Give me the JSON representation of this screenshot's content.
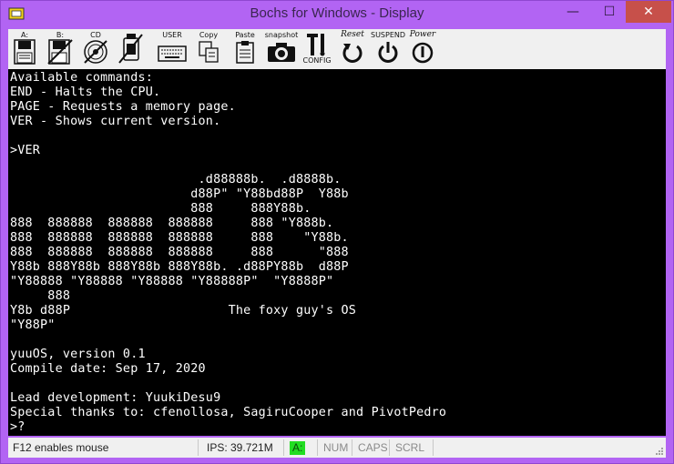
{
  "window": {
    "title": "Bochs for Windows - Display",
    "minimize_glyph": "—",
    "maximize_glyph": "☐",
    "close_glyph": "✕"
  },
  "toolbar": {
    "floppy_a_label": "A:",
    "floppy_b_label": "B:",
    "cdrom_label": "CD",
    "user_label": "USER",
    "copy_label": "Copy",
    "paste_label": "Paste",
    "snapshot_label": "snapshot",
    "config_label": "CONFIG",
    "reset_label": "Reset",
    "suspend_label": "SUSPEND",
    "power_label": "Power",
    "icons": [
      "floppy-a-icon",
      "floppy-b-icon",
      "cdrom-icon",
      "usb-icon",
      "keyboard-icon",
      "copy-icon",
      "paste-icon",
      "camera-icon",
      "config-icon",
      "reset-icon",
      "suspend-icon",
      "power-icon"
    ]
  },
  "console": {
    "lines": [
      "Available commands:",
      "END - Halts the CPU.",
      "PAGE - Requests a memory page.",
      "VER - Shows current version.",
      "",
      ">VER",
      "",
      "                         .d88888b.  .d8888b.",
      "                        d88P\" \"Y88bd88P  Y88b",
      "                        888     888Y88b.",
      "888  888888  888888  888888     888 \"Y888b.",
      "888  888888  888888  888888     888    \"Y88b.",
      "888  888888  888888  888888     888      \"888",
      "Y88b 888Y88b 888Y88b 888Y88b. .d88PY88b  d88P",
      "\"Y88888 \"Y88888 \"Y88888 \"Y88888P\"  \"Y8888P\"",
      "     888",
      "Y8b d88P                     The foxy guy's OS",
      "\"Y88P\"",
      "",
      "yuuOS, version 0.1",
      "Compile date: Sep 17, 2020",
      "",
      "Lead development: YuukiDesu9",
      "Special thanks to: cfenollosa, SagiruCooper and PivotPedro",
      ">?"
    ]
  },
  "statusbar": {
    "mouse_hint": "F12 enables mouse",
    "ips": "IPS: 39.721M",
    "drive": "A:",
    "num": "NUM",
    "caps": "CAPS",
    "scrl": "SCRL"
  },
  "colors": {
    "titlebar": "#b264f3",
    "drive_active": "#22dd22",
    "console_bg": "#000000",
    "console_fg": "#ffffff"
  }
}
